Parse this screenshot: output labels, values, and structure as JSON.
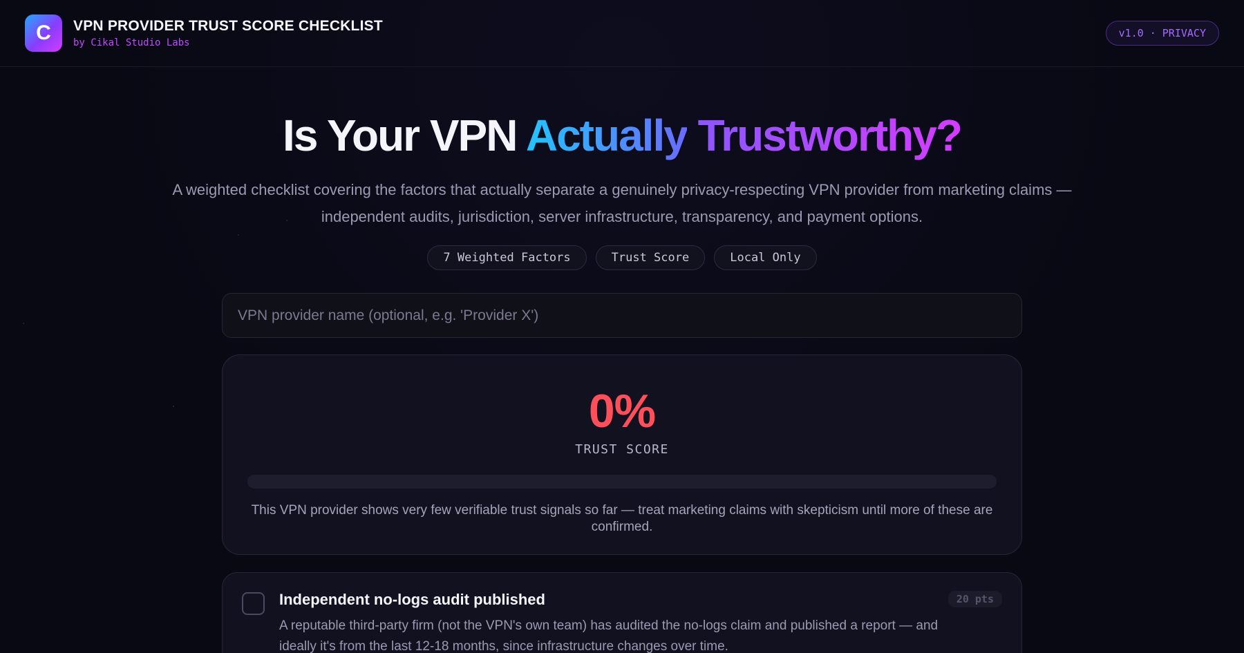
{
  "header": {
    "logo_letter": "C",
    "title": "VPN PROVIDER TRUST SCORE CHECKLIST",
    "subtitle": "by Cikal Studio Labs",
    "version_badge": "v1.0 · PRIVACY"
  },
  "hero": {
    "title_part1": "Is Your VPN ",
    "title_part2": "Actually",
    "title_part3": " Trustworthy?",
    "description": "A weighted checklist covering the factors that actually separate a genuinely privacy-respecting VPN provider from marketing claims — independent audits, jurisdiction, server infrastructure, transparency, and payment options.",
    "tags": [
      "7 Weighted Factors",
      "Trust Score",
      "Local Only"
    ]
  },
  "provider_input": {
    "value": "",
    "placeholder": "VPN provider name (optional, e.g. 'Provider X')"
  },
  "score": {
    "value": "0%",
    "label": "TRUST SCORE",
    "progress_fraction": 0,
    "message": "This VPN provider shows very few verifiable trust signals so far — treat marketing claims with skepticism until more of these are confirmed.",
    "color": "#ff4f5a"
  },
  "factors": [
    {
      "title": "Independent no-logs audit published",
      "description": "A reputable third-party firm (not the VPN's own team) has audited the no-logs claim and published a report — and ideally it's from the last 12-18 months, since infrastructure changes over time.",
      "points": "20 pts",
      "checked": false
    }
  ],
  "colors": {
    "background": "#090914",
    "accent_blue": "#23c4ff",
    "accent_purple": "#c04bff"
  }
}
